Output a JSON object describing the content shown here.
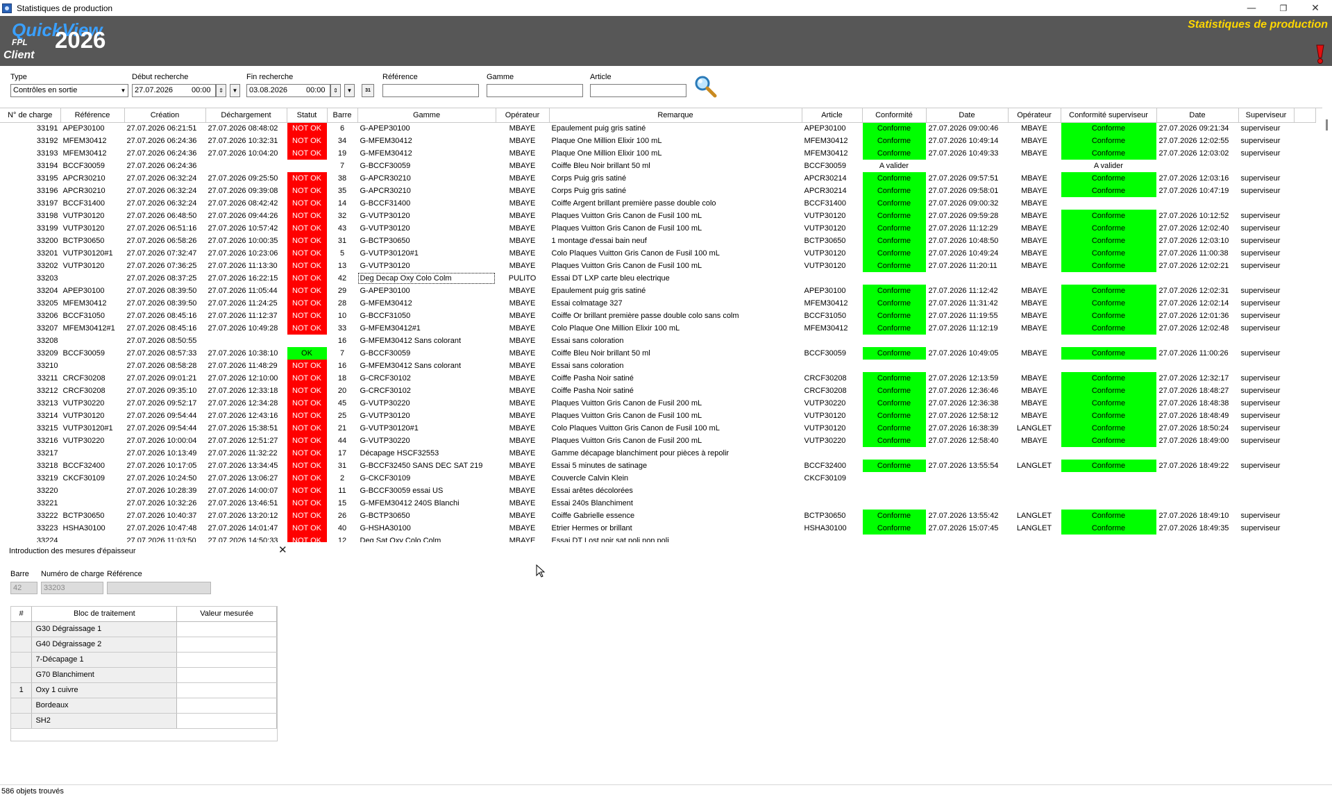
{
  "window": {
    "title": "Statistiques de production",
    "controls": [
      "—",
      "❐",
      "✕"
    ]
  },
  "header": {
    "brand": "QuickView",
    "brand_sub": "FPL",
    "year": "2026",
    "client": "Client",
    "title": "Statistiques de production",
    "colors": {
      "background": "#575757",
      "brand": "#3aa0ff",
      "title": "#ffd700"
    }
  },
  "filters": {
    "type_label": "Type",
    "type_value": "Contrôles en sortie",
    "debut_label": "Début recherche",
    "debut_date": "27.07.2026",
    "debut_time": "00:00",
    "fin_label": "Fin recherche",
    "fin_date": "03.08.2026",
    "fin_time": "00:00",
    "calendar_label": "31",
    "reference_label": "Référence",
    "reference_value": "",
    "gamme_label": "Gamme",
    "gamme_value": "",
    "article_label": "Article",
    "article_value": ""
  },
  "grid": {
    "columns": [
      "N° de charge",
      "Référence",
      "Création",
      "Déchargement",
      "Statut",
      "Barre",
      "Gamme",
      "Opérateur",
      "Remarque",
      "Article",
      "Conformité",
      "Date",
      "Opérateur",
      "Conformité superviseur",
      "Date",
      "Superviseur"
    ],
    "rows": [
      [
        "33191",
        "APEP30100",
        "27.07.2026 06:21:51",
        "27.07.2026 08:48:02",
        "NOT OK",
        "6",
        "G-APEP30100",
        "MBAYE",
        "Epaulement puig gris satiné",
        "APEP30100",
        "Conforme",
        "27.07.2026 09:00:46",
        "MBAYE",
        "Conforme",
        "27.07.2026 09:21:34",
        "superviseur"
      ],
      [
        "33192",
        "MFEM30412",
        "27.07.2026 06:24:36",
        "27.07.2026 10:32:31",
        "NOT OK",
        "34",
        "G-MFEM30412",
        "MBAYE",
        "Plaque One Million Elixir 100 mL",
        "MFEM30412",
        "Conforme",
        "27.07.2026 10:49:14",
        "MBAYE",
        "Conforme",
        "27.07.2026 12:02:55",
        "superviseur"
      ],
      [
        "33193",
        "MFEM30412",
        "27.07.2026 06:24:36",
        "27.07.2026 10:04:20",
        "NOT OK",
        "19",
        "G-MFEM30412",
        "MBAYE",
        "Plaque One Million Elixir 100 mL",
        "MFEM30412",
        "Conforme",
        "27.07.2026 10:49:33",
        "MBAYE",
        "Conforme",
        "27.07.2026 12:03:02",
        "superviseur"
      ],
      [
        "33194",
        "BCCF30059",
        "27.07.2026 06:24:36",
        "",
        "",
        "7",
        "G-BCCF30059",
        "MBAYE",
        "Coiffe Bleu Noir brillant 50 ml",
        "BCCF30059",
        "A valider",
        "",
        "",
        "A valider",
        "",
        ""
      ],
      [
        "33195",
        "APCR30210",
        "27.07.2026 06:32:24",
        "27.07.2026 09:25:50",
        "NOT OK",
        "38",
        "G-APCR30210",
        "MBAYE",
        "Corps Puig gris satiné",
        "APCR30214",
        "Conforme",
        "27.07.2026 09:57:51",
        "MBAYE",
        "Conforme",
        "27.07.2026 12:03:16",
        "superviseur"
      ],
      [
        "33196",
        "APCR30210",
        "27.07.2026 06:32:24",
        "27.07.2026 09:39:08",
        "NOT OK",
        "35",
        "G-APCR30210",
        "MBAYE",
        "Corps Puig gris satiné",
        "APCR30214",
        "Conforme",
        "27.07.2026 09:58:01",
        "MBAYE",
        "Conforme",
        "27.07.2026 10:47:19",
        "superviseur"
      ],
      [
        "33197",
        "BCCF31400",
        "27.07.2026 06:32:24",
        "27.07.2026 08:42:42",
        "NOT OK",
        "14",
        "G-BCCF31400",
        "MBAYE",
        "Coiffe Argent brillant première passe double colo",
        "BCCF31400",
        "Conforme",
        "27.07.2026 09:00:32",
        "MBAYE",
        "",
        "",
        ""
      ],
      [
        "33198",
        "VUTP30120",
        "27.07.2026 06:48:50",
        "27.07.2026 09:44:26",
        "NOT OK",
        "32",
        "G-VUTP30120",
        "MBAYE",
        "Plaques Vuitton Gris Canon de Fusil 100 mL",
        "VUTP30120",
        "Conforme",
        "27.07.2026 09:59:28",
        "MBAYE",
        "Conforme",
        "27.07.2026 10:12:52",
        "superviseur"
      ],
      [
        "33199",
        "VUTP30120",
        "27.07.2026 06:51:16",
        "27.07.2026 10:57:42",
        "NOT OK",
        "43",
        "G-VUTP30120",
        "MBAYE",
        "Plaques Vuitton Gris Canon de Fusil 100 mL",
        "VUTP30120",
        "Conforme",
        "27.07.2026 11:12:29",
        "MBAYE",
        "Conforme",
        "27.07.2026 12:02:40",
        "superviseur"
      ],
      [
        "33200",
        "BCTP30650",
        "27.07.2026 06:58:26",
        "27.07.2026 10:00:35",
        "NOT OK",
        "31",
        "G-BCTP30650",
        "MBAYE",
        "1 montage d'essai bain neuf",
        "BCTP30650",
        "Conforme",
        "27.07.2026 10:48:50",
        "MBAYE",
        "Conforme",
        "27.07.2026 12:03:10",
        "superviseur"
      ],
      [
        "33201",
        "VUTP30120#1",
        "27.07.2026 07:32:47",
        "27.07.2026 10:23:06",
        "NOT OK",
        "5",
        "G-VUTP30120#1",
        "MBAYE",
        "Colo Plaques Vuitton Gris Canon de Fusil 100 mL",
        "VUTP30120",
        "Conforme",
        "27.07.2026 10:49:24",
        "MBAYE",
        "Conforme",
        "27.07.2026 11:00:38",
        "superviseur"
      ],
      [
        "33202",
        "VUTP30120",
        "27.07.2026 07:36:25",
        "27.07.2026 11:13:30",
        "NOT OK",
        "13",
        "G-VUTP30120",
        "MBAYE",
        "Plaques Vuitton Gris Canon de Fusil 100 mL",
        "VUTP30120",
        "Conforme",
        "27.07.2026 11:20:11",
        "MBAYE",
        "Conforme",
        "27.07.2026 12:02:21",
        "superviseur"
      ],
      [
        "33203",
        "",
        "27.07.2026 08:37:25",
        "27.07.2026 16:22:15",
        "NOT OK",
        "42",
        "Deg Decap Oxy Colo Colm",
        "PULITO",
        "Essai DT LXP carte bleu electrique",
        "",
        "",
        "",
        "",
        "",
        "",
        ""
      ],
      [
        "33204",
        "APEP30100",
        "27.07.2026 08:39:50",
        "27.07.2026 11:05:44",
        "NOT OK",
        "29",
        "G-APEP30100",
        "MBAYE",
        "Epaulement puig gris satiné",
        "APEP30100",
        "Conforme",
        "27.07.2026 11:12:42",
        "MBAYE",
        "Conforme",
        "27.07.2026 12:02:31",
        "superviseur"
      ],
      [
        "33205",
        "MFEM30412",
        "27.07.2026 08:39:50",
        "27.07.2026 11:24:25",
        "NOT OK",
        "28",
        "G-MFEM30412",
        "MBAYE",
        "Essai colmatage 327",
        "MFEM30412",
        "Conforme",
        "27.07.2026 11:31:42",
        "MBAYE",
        "Conforme",
        "27.07.2026 12:02:14",
        "superviseur"
      ],
      [
        "33206",
        "BCCF31050",
        "27.07.2026 08:45:16",
        "27.07.2026 11:12:37",
        "NOT OK",
        "10",
        "G-BCCF31050",
        "MBAYE",
        "Coiffe Or brillant première passe double colo sans colm",
        "BCCF31050",
        "Conforme",
        "27.07.2026 11:19:55",
        "MBAYE",
        "Conforme",
        "27.07.2026 12:01:36",
        "superviseur"
      ],
      [
        "33207",
        "MFEM30412#1",
        "27.07.2026 08:45:16",
        "27.07.2026 10:49:28",
        "NOT OK",
        "33",
        "G-MFEM30412#1",
        "MBAYE",
        "Colo Plaque One Million Elixir 100 mL",
        "MFEM30412",
        "Conforme",
        "27.07.2026 11:12:19",
        "MBAYE",
        "Conforme",
        "27.07.2026 12:02:48",
        "superviseur"
      ],
      [
        "33208",
        "",
        "27.07.2026 08:50:55",
        "",
        "",
        "16",
        "G-MFEM30412 Sans colorant",
        "MBAYE",
        "Essai sans coloration",
        "",
        "",
        "",
        "",
        "",
        "",
        ""
      ],
      [
        "33209",
        "BCCF30059",
        "27.07.2026 08:57:33",
        "27.07.2026 10:38:10",
        "OK",
        "7",
        "G-BCCF30059",
        "MBAYE",
        "Coiffe Bleu Noir brillant 50 ml",
        "BCCF30059",
        "Conforme",
        "27.07.2026 10:49:05",
        "MBAYE",
        "Conforme",
        "27.07.2026 11:00:26",
        "superviseur"
      ],
      [
        "33210",
        "",
        "27.07.2026 08:58:28",
        "27.07.2026 11:48:29",
        "NOT OK",
        "16",
        "G-MFEM30412 Sans colorant",
        "MBAYE",
        "Essai sans coloration",
        "",
        "",
        "",
        "",
        "",
        "",
        ""
      ],
      [
        "33211",
        "CRCF30208",
        "27.07.2026 09:01:21",
        "27.07.2026 12:10:00",
        "NOT OK",
        "18",
        "G-CRCF30102",
        "MBAYE",
        "Coiffe Pasha Noir satiné",
        "CRCF30208",
        "Conforme",
        "27.07.2026 12:13:59",
        "MBAYE",
        "Conforme",
        "27.07.2026 12:32:17",
        "superviseur"
      ],
      [
        "33212",
        "CRCF30208",
        "27.07.2026 09:35:10",
        "27.07.2026 12:33:18",
        "NOT OK",
        "20",
        "G-CRCF30102",
        "MBAYE",
        "Coiffe Pasha Noir satiné",
        "CRCF30208",
        "Conforme",
        "27.07.2026 12:36:46",
        "MBAYE",
        "Conforme",
        "27.07.2026 18:48:27",
        "superviseur"
      ],
      [
        "33213",
        "VUTP30220",
        "27.07.2026 09:52:17",
        "27.07.2026 12:34:28",
        "NOT OK",
        "45",
        "G-VUTP30220",
        "MBAYE",
        "Plaques Vuitton Gris Canon de Fusil 200 mL",
        "VUTP30220",
        "Conforme",
        "27.07.2026 12:36:38",
        "MBAYE",
        "Conforme",
        "27.07.2026 18:48:38",
        "superviseur"
      ],
      [
        "33214",
        "VUTP30120",
        "27.07.2026 09:54:44",
        "27.07.2026 12:43:16",
        "NOT OK",
        "25",
        "G-VUTP30120",
        "MBAYE",
        "Plaques Vuitton Gris Canon de Fusil 100 mL",
        "VUTP30120",
        "Conforme",
        "27.07.2026 12:58:12",
        "MBAYE",
        "Conforme",
        "27.07.2026 18:48:49",
        "superviseur"
      ],
      [
        "33215",
        "VUTP30120#1",
        "27.07.2026 09:54:44",
        "27.07.2026 15:38:51",
        "NOT OK",
        "21",
        "G-VUTP30120#1",
        "MBAYE",
        "Colo Plaques Vuitton Gris Canon de Fusil 100 mL",
        "VUTP30120",
        "Conforme",
        "27.07.2026 16:38:39",
        "LANGLET",
        "Conforme",
        "27.07.2026 18:50:24",
        "superviseur"
      ],
      [
        "33216",
        "VUTP30220",
        "27.07.2026 10:00:04",
        "27.07.2026 12:51:27",
        "NOT OK",
        "44",
        "G-VUTP30220",
        "MBAYE",
        "Plaques Vuitton Gris Canon de Fusil 200 mL",
        "VUTP30220",
        "Conforme",
        "27.07.2026 12:58:40",
        "MBAYE",
        "Conforme",
        "27.07.2026 18:49:00",
        "superviseur"
      ],
      [
        "33217",
        "",
        "27.07.2026 10:13:49",
        "27.07.2026 11:32:22",
        "NOT OK",
        "17",
        "Décapage HSCF32553",
        "MBAYE",
        "Gamme décapage blanchiment pour pièces à repolir",
        "",
        "",
        "",
        "",
        "",
        "",
        ""
      ],
      [
        "33218",
        "BCCF32400",
        "27.07.2026 10:17:05",
        "27.07.2026 13:34:45",
        "NOT OK",
        "31",
        "G-BCCF32450 SANS DEC SAT 219",
        "MBAYE",
        "Essai 5 minutes de satinage",
        "BCCF32400",
        "Conforme",
        "27.07.2026 13:55:54",
        "LANGLET",
        "Conforme",
        "27.07.2026 18:49:22",
        "superviseur"
      ],
      [
        "33219",
        "CKCF30109",
        "27.07.2026 10:24:50",
        "27.07.2026 13:06:27",
        "NOT OK",
        "2",
        "G-CKCF30109",
        "MBAYE",
        "Couvercle Calvin Klein",
        "CKCF30109",
        "",
        "",
        "",
        "",
        "",
        ""
      ],
      [
        "33220",
        "",
        "27.07.2026 10:28:39",
        "27.07.2026 14:00:07",
        "NOT OK",
        "11",
        "G-BCCF30059 essai US",
        "MBAYE",
        "Essai arêtes décolorées",
        "",
        "",
        "",
        "",
        "",
        "",
        ""
      ],
      [
        "33221",
        "",
        "27.07.2026 10:32:26",
        "27.07.2026 13:46:51",
        "NOT OK",
        "15",
        "G-MFEM30412 240S Blanchi",
        "MBAYE",
        "Essai 240s Blanchiment",
        "",
        "",
        "",
        "",
        "",
        "",
        ""
      ],
      [
        "33222",
        "BCTP30650",
        "27.07.2026 10:40:37",
        "27.07.2026 13:20:12",
        "NOT OK",
        "26",
        "G-BCTP30650",
        "MBAYE",
        "Coiffe Gabrielle essence",
        "BCTP30650",
        "Conforme",
        "27.07.2026 13:55:42",
        "LANGLET",
        "Conforme",
        "27.07.2026 18:49:10",
        "superviseur"
      ],
      [
        "33223",
        "HSHA30100",
        "27.07.2026 10:47:48",
        "27.07.2026 14:01:47",
        "NOT OK",
        "40",
        "G-HSHA30100",
        "MBAYE",
        "Etrier Hermes or brillant",
        "HSHA30100",
        "Conforme",
        "27.07.2026 15:07:45",
        "LANGLET",
        "Conforme",
        "27.07.2026 18:49:35",
        "superviseur"
      ],
      [
        "33224",
        "",
        "27.07.2026 11:03:50",
        "27.07.2026 14:50:33",
        "NOT OK",
        "12",
        "Deg Sat Oxy Colo Colm",
        "MBAYE",
        "Essai DT Lost noir sat poli non poli",
        "",
        "",
        "",
        "",
        "",
        "",
        ""
      ]
    ],
    "colors": {
      "not_ok": "#ff0000",
      "ok": "#00ff00",
      "conforme": "#00ff00"
    }
  },
  "lower": {
    "title": "Introduction des mesures d'épaisseur",
    "barre_label": "Barre",
    "barre_value": "42",
    "charge_label": "Numéro de charge",
    "charge_value": "33203",
    "ref_label": "Référence",
    "ref_value": "",
    "table": {
      "columns": [
        "#",
        "Bloc de traitement",
        "Valeur mesurée"
      ],
      "rows": [
        [
          "",
          "G30 Dégraissage 1",
          ""
        ],
        [
          "",
          "G40 Dégraissage 2",
          ""
        ],
        [
          "",
          "7-Décapage 1",
          ""
        ],
        [
          "",
          "G70 Blanchiment",
          ""
        ],
        [
          "1",
          "Oxy 1 cuivre",
          ""
        ],
        [
          "",
          "Bordeaux",
          ""
        ],
        [
          "",
          "SH2",
          ""
        ]
      ]
    }
  },
  "status": {
    "text": "586 objets trouvés"
  }
}
